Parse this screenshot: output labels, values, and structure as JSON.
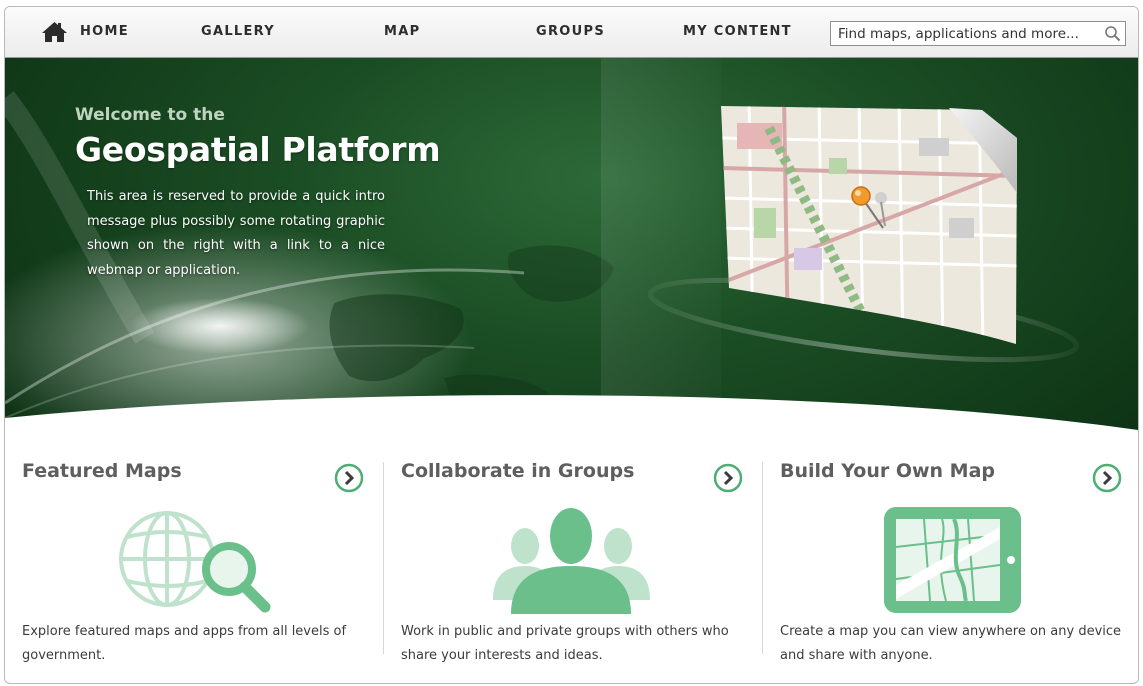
{
  "nav": {
    "items": [
      "HOME",
      "GALLERY",
      "MAP",
      "GROUPS",
      "MY CONTENT"
    ],
    "search_placeholder": "Find maps, applications and more..."
  },
  "hero": {
    "pretitle": "Welcome to the",
    "title": "Geospatial Platform",
    "body": "This area is reserved to provide a quick intro message plus possibly some rotating graphic shown on the right with a link to a nice webmap or application."
  },
  "cards": [
    {
      "title": "Featured Maps",
      "text": "Explore featured maps and apps from all levels of government.",
      "icon": "globe-search-icon"
    },
    {
      "title": "Collaborate in Groups",
      "text": "Work in public and private groups with others who share your interests and ideas.",
      "icon": "group-people-icon"
    },
    {
      "title": "Build Your Own Map",
      "text": "Create a map you can view anywhere on any device and share with anyone.",
      "icon": "tablet-map-icon"
    }
  ],
  "colors": {
    "hero_green": "#1b4d24",
    "icon_green": "#6abf8a",
    "icon_light": "#b8e0c6",
    "arrow_green": "#4fae74"
  }
}
